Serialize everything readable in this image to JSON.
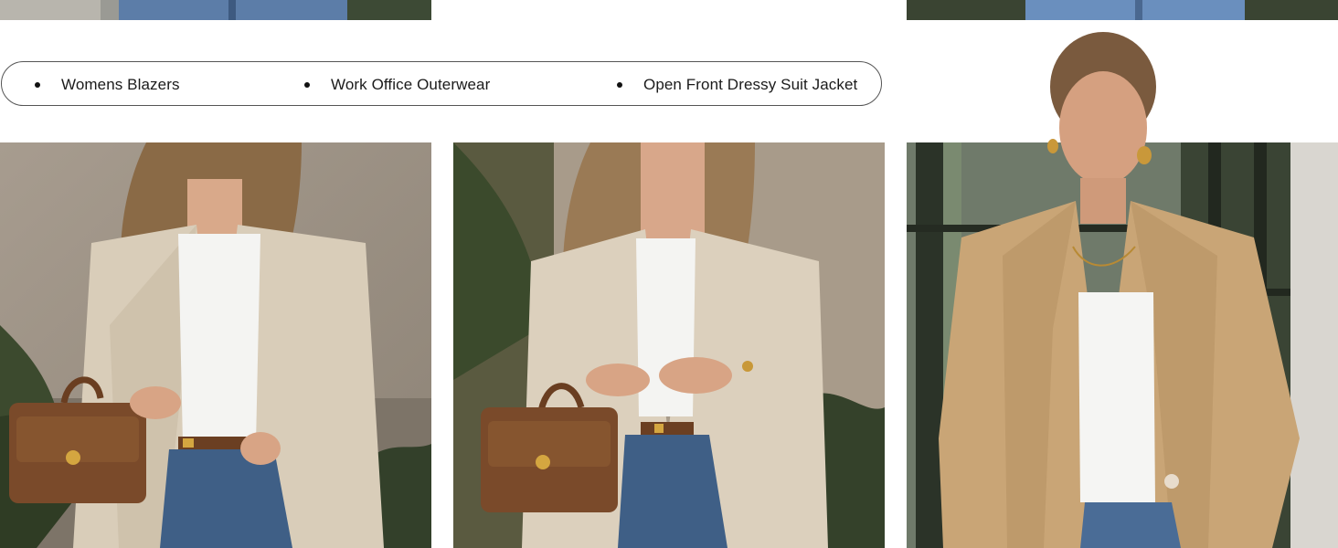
{
  "keywords": [
    {
      "label": "Womens Blazers"
    },
    {
      "label": "Work Office Outerwear"
    },
    {
      "label": "Open Front Dressy Suit Jacket"
    }
  ],
  "colors": {
    "page_bg": "#ffffff",
    "pill_border": "#555555",
    "blazer_light": "#d9ccb8",
    "blazer_khaki": "#c9a576",
    "denim": "#3f5f86",
    "bag": "#7a4a2a",
    "top": "#f4f4f2"
  },
  "photos": [
    {
      "name": "top-left-crop"
    },
    {
      "name": "top-right-crop"
    },
    {
      "name": "model-beige-blazer-bag-left"
    },
    {
      "name": "model-beige-blazer-bag-center"
    },
    {
      "name": "model-khaki-blazer-right"
    }
  ]
}
